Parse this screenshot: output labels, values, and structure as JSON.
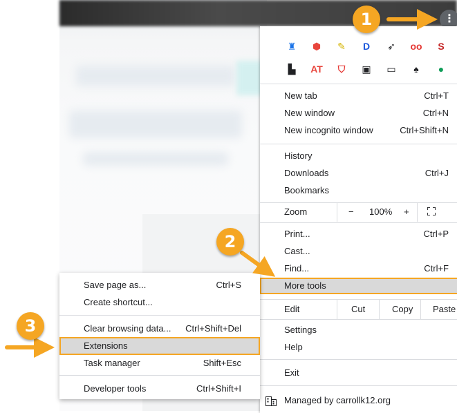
{
  "browser_menu": {
    "extensions_row1": [
      {
        "icon": "ext-hat-icon",
        "glyph": "♜",
        "color": "#1a73e8"
      },
      {
        "icon": "ext-hex-icon",
        "glyph": "⬢",
        "color": "#e8453c"
      },
      {
        "icon": "ext-pencil-icon",
        "glyph": "✎",
        "color": "#d4b300"
      },
      {
        "icon": "ext-d-icon",
        "glyph": "D",
        "color": "#1a56db"
      },
      {
        "icon": "ext-rocket-icon",
        "glyph": "➶",
        "color": "#202124"
      },
      {
        "icon": "ext-oo-icon",
        "glyph": "oo",
        "color": "#e53935"
      },
      {
        "icon": "ext-s-icon",
        "glyph": "S",
        "color": "#c62828"
      },
      {
        "icon": "ext-blank-icon",
        "glyph": "□",
        "color": "#9aa0a6"
      }
    ],
    "extensions_row2": [
      {
        "icon": "ext-bookmark-icon",
        "glyph": "▙",
        "color": "#202124"
      },
      {
        "icon": "ext-at-icon",
        "glyph": "AT",
        "color": "#e8453c"
      },
      {
        "icon": "ext-shield-icon",
        "glyph": "⛉",
        "color": "#e53935"
      },
      {
        "icon": "ext-badge-icon",
        "glyph": "▣",
        "color": "#202124"
      },
      {
        "icon": "ext-screen-icon",
        "glyph": "▭",
        "color": "#202124"
      },
      {
        "icon": "ext-spy-icon",
        "glyph": "♠",
        "color": "#202124"
      },
      {
        "icon": "ext-bubble-icon",
        "glyph": "●",
        "color": "#0f9d58"
      }
    ],
    "new_tab": {
      "label": "New tab",
      "shortcut": "Ctrl+T"
    },
    "new_window": {
      "label": "New window",
      "shortcut": "Ctrl+N"
    },
    "new_incognito": {
      "label": "New incognito window",
      "shortcut": "Ctrl+Shift+N"
    },
    "history": {
      "label": "History"
    },
    "downloads": {
      "label": "Downloads",
      "shortcut": "Ctrl+J"
    },
    "bookmarks": {
      "label": "Bookmarks"
    },
    "zoom": {
      "label": "Zoom",
      "minus": "−",
      "value": "100%",
      "plus": "+"
    },
    "print": {
      "label": "Print...",
      "shortcut": "Ctrl+P"
    },
    "cast": {
      "label": "Cast..."
    },
    "find": {
      "label": "Find...",
      "shortcut": "Ctrl+F"
    },
    "more_tools": {
      "label": "More tools"
    },
    "edit": {
      "label": "Edit",
      "cut": "Cut",
      "copy": "Copy",
      "paste": "Paste"
    },
    "settings": {
      "label": "Settings"
    },
    "help": {
      "label": "Help"
    },
    "exit": {
      "label": "Exit"
    },
    "managed": {
      "label": "Managed by carrollk12.org"
    }
  },
  "more_tools_submenu": {
    "save_page": {
      "label": "Save page as...",
      "shortcut": "Ctrl+S"
    },
    "create_shortcut": {
      "label": "Create shortcut..."
    },
    "clear_data": {
      "label": "Clear browsing data...",
      "shortcut": "Ctrl+Shift+Del"
    },
    "extensions": {
      "label": "Extensions"
    },
    "task_manager": {
      "label": "Task manager",
      "shortcut": "Shift+Esc"
    },
    "dev_tools": {
      "label": "Developer tools",
      "shortcut": "Ctrl+Shift+I"
    }
  },
  "annotations": {
    "step1": "1",
    "step2": "2",
    "step3": "3",
    "accent_color": "#f5a623"
  },
  "kebab": {
    "glyph": "⋮"
  }
}
